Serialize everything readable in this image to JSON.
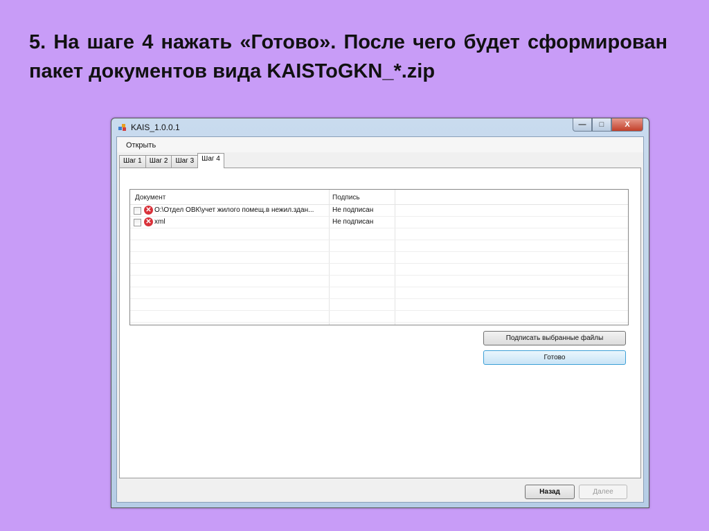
{
  "slide": {
    "heading": "5. На шаге 4 нажать «Готово». После чего будет сформирован пакет документов вида KAISToGKN_*.zip"
  },
  "window": {
    "title": "KAIS_1.0.0.1",
    "icon": "app-icon",
    "minimize": "—",
    "maximize": "□",
    "close": "X"
  },
  "menu": {
    "open": "Открыть"
  },
  "tabs": [
    {
      "label": "Шаг 1"
    },
    {
      "label": "Шаг 2"
    },
    {
      "label": "Шаг 3"
    },
    {
      "label": "Шаг 4",
      "active": true
    }
  ],
  "table": {
    "columns": [
      "Документ",
      "Подпись"
    ],
    "rows": [
      {
        "checked": false,
        "status_icon": "error-icon",
        "document": "O:\\Отдел ОВК\\учет жилого помещ.в нежил.здан...",
        "signature": "Не подписан"
      },
      {
        "checked": false,
        "status_icon": "error-icon",
        "document": "xml",
        "signature": "Не подписан"
      }
    ]
  },
  "buttons": {
    "sign_selected": "Подписать выбранные файлы",
    "done": "Готово",
    "back": "Назад",
    "next": "Далее"
  },
  "colors": {
    "background": "#c89cf7",
    "error": "#d9323a",
    "focus": "#3c9fd6"
  }
}
